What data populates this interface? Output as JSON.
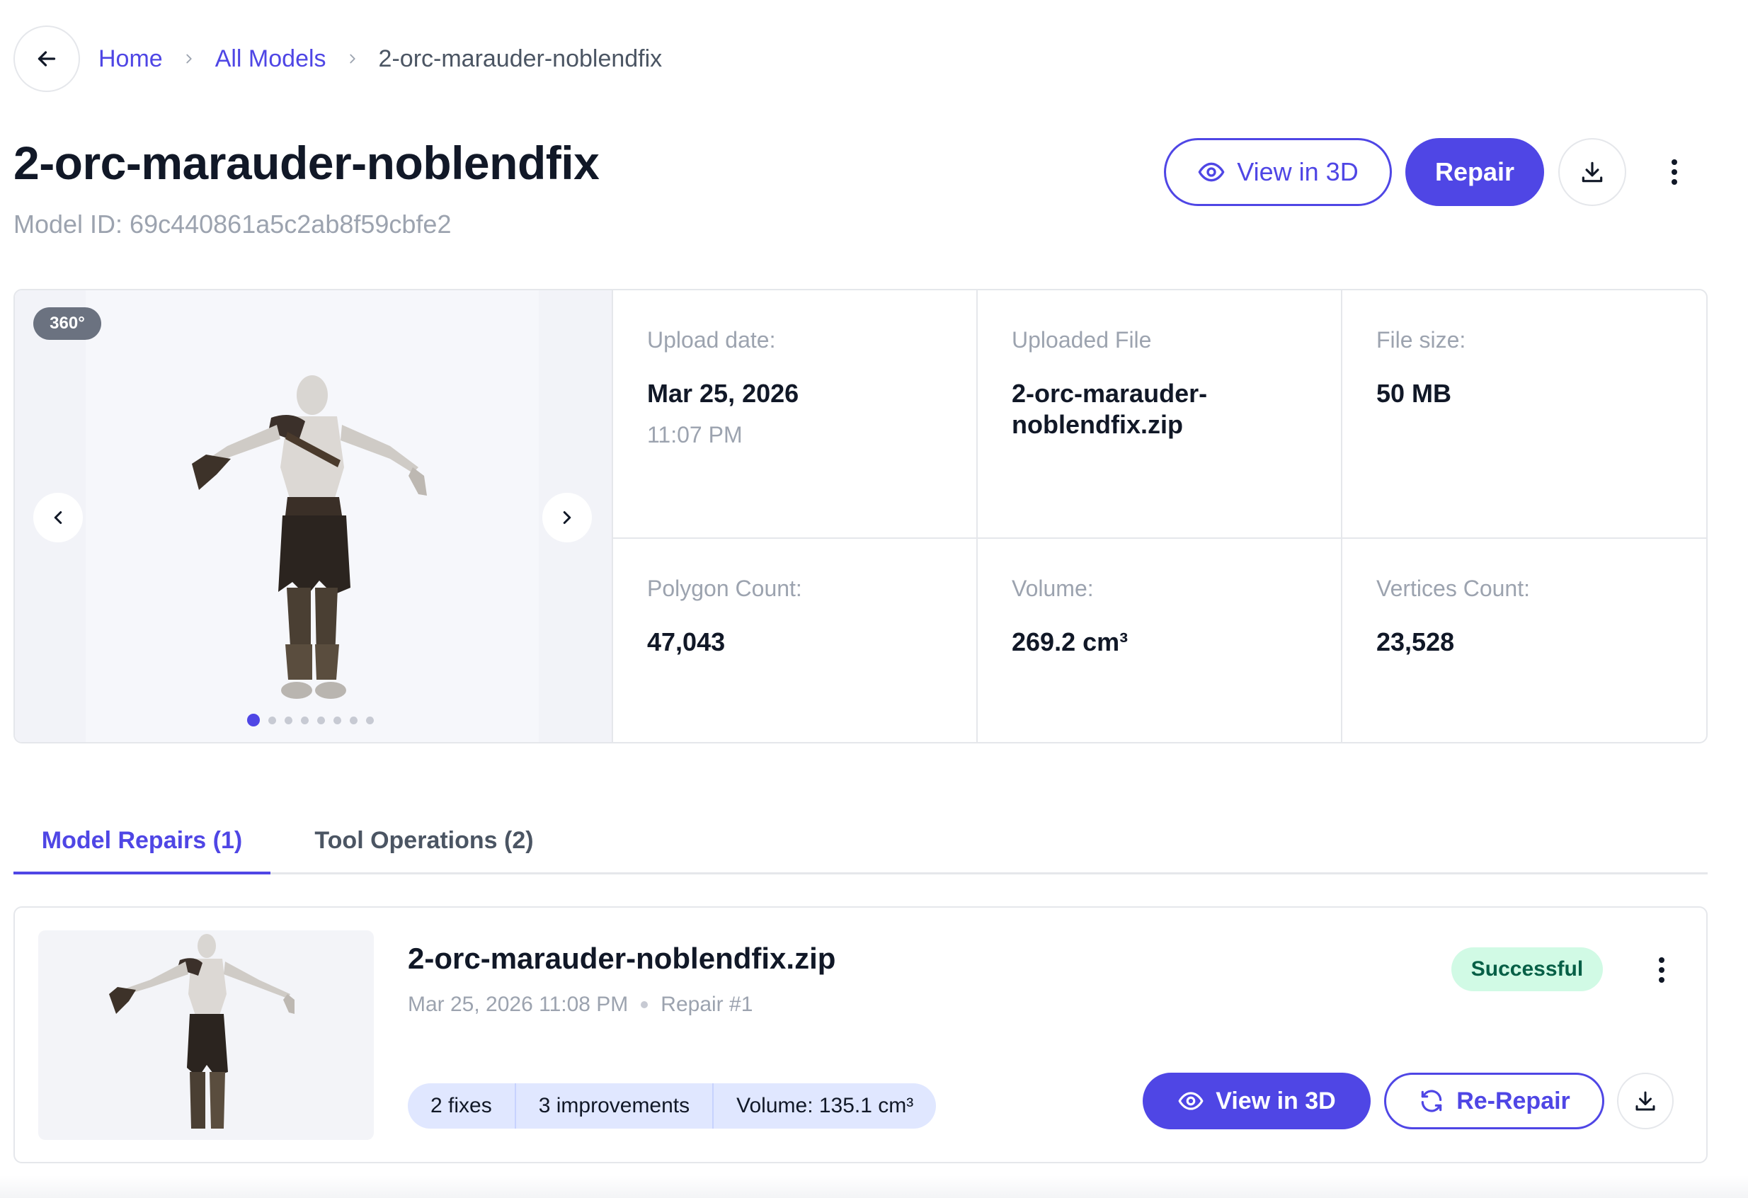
{
  "breadcrumb": {
    "home": "Home",
    "all_models": "All Models",
    "current": "2-orc-marauder-noblendfix"
  },
  "header": {
    "title": "2-orc-marauder-noblendfix",
    "model_id": "Model ID: 69c440861a5c2ab8f59cbfe2",
    "view_3d_label": "View in 3D",
    "repair_label": "Repair"
  },
  "viewer": {
    "badge": "360°",
    "slide_count": 8,
    "active_slide": 1
  },
  "stats": [
    {
      "label": "Upload date:",
      "value": "Mar 25, 2026",
      "sub": "11:07 PM"
    },
    {
      "label": "Uploaded File",
      "value": "2-orc-marauder-noblendfix.zip",
      "sub": ""
    },
    {
      "label": "File size:",
      "value": "50 MB",
      "sub": ""
    },
    {
      "label": "Polygon Count:",
      "value": "47,043",
      "sub": ""
    },
    {
      "label": "Volume:",
      "value": "269.2 cm³",
      "sub": ""
    },
    {
      "label": "Vertices Count:",
      "value": "23,528",
      "sub": ""
    }
  ],
  "tabs": [
    {
      "label": "Model Repairs (1)",
      "active": true
    },
    {
      "label": "Tool Operations (2)",
      "active": false
    }
  ],
  "repair": {
    "title": "2-orc-marauder-noblendfix.zip",
    "date": "Mar 25, 2026 11:08 PM",
    "repair_number": "Repair #1",
    "status": "Successful",
    "pills": [
      "2 fixes",
      "3 improvements",
      "Volume: 135.1 cm³"
    ],
    "view_3d_label": "View in 3D",
    "re_repair_label": "Re-Repair"
  },
  "colors": {
    "accent": "#4f46e5",
    "success_bg": "#d1fae5",
    "muted_text": "#9ca3af"
  }
}
